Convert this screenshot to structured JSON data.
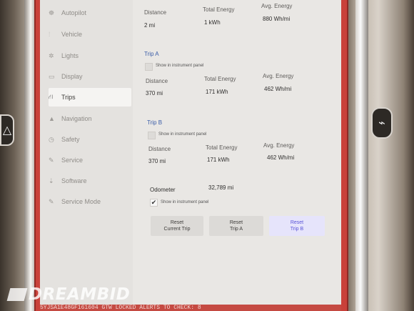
{
  "sidebar": {
    "items": [
      {
        "label": "Autopilot",
        "icon": "steering-icon",
        "glyph": "☸",
        "active": false
      },
      {
        "label": "Vehicle",
        "icon": "sliders-icon",
        "glyph": "⫶",
        "active": false
      },
      {
        "label": "Lights",
        "icon": "sun-icon",
        "glyph": "✲",
        "active": false
      },
      {
        "label": "Display",
        "icon": "display-icon",
        "glyph": "▭",
        "active": false
      },
      {
        "label": "Trips",
        "icon": "trips-icon",
        "glyph": "⛙",
        "active": true
      },
      {
        "label": "Navigation",
        "icon": "navigation-icon",
        "glyph": "▲",
        "active": false
      },
      {
        "label": "Safety",
        "icon": "safety-icon",
        "glyph": "◷",
        "active": false
      },
      {
        "label": "Service",
        "icon": "wrench-icon",
        "glyph": "✎",
        "active": false
      },
      {
        "label": "Software",
        "icon": "download-icon",
        "glyph": "⇣",
        "active": false
      },
      {
        "label": "Service Mode",
        "icon": "service-mode-icon",
        "glyph": "✎",
        "active": false
      }
    ]
  },
  "current_trip": {
    "distance_label": "Distance",
    "distance": "2 mi",
    "energy_label": "Total Energy",
    "energy": "1 kWh",
    "avg_label": "Avg. Energy",
    "avg": "880 Wh/mi"
  },
  "trip_a": {
    "title": "Trip A",
    "checkbox_label": "Show in instrument panel",
    "checked": false,
    "distance_label": "Distance",
    "distance": "370 mi",
    "energy_label": "Total Energy",
    "energy": "171 kWh",
    "avg_label": "Avg. Energy",
    "avg": "462 Wh/mi"
  },
  "trip_b": {
    "title": "Trip B",
    "checkbox_label": "Show in instrument panel",
    "checked": false,
    "distance_label": "Distance",
    "distance": "370 mi",
    "energy_label": "Total Energy",
    "energy": "171 kWh",
    "avg_label": "Avg. Energy",
    "avg": "462 Wh/mi"
  },
  "odometer": {
    "label": "Odometer",
    "value": "32,789 mi",
    "checkbox_label": "Show in instrument panel",
    "checked": true,
    "check_glyph": "✔"
  },
  "buttons": {
    "reset_current": {
      "line1": "Reset",
      "line2": "Current Trip"
    },
    "reset_a": {
      "line1": "Reset",
      "line2": "Trip A"
    },
    "reset_b": {
      "line1": "Reset",
      "line2": "Trip B"
    }
  },
  "status_bar": {
    "text": "5YJSA1E48GF161604   GTW LOCKED   ALERTS TO CHECK: 8"
  },
  "watermark": {
    "text": "DREAMBID"
  },
  "colors": {
    "accent_blue": "#3a5da8",
    "active_button": "#5a55d8",
    "status_red": "#c54a42"
  }
}
